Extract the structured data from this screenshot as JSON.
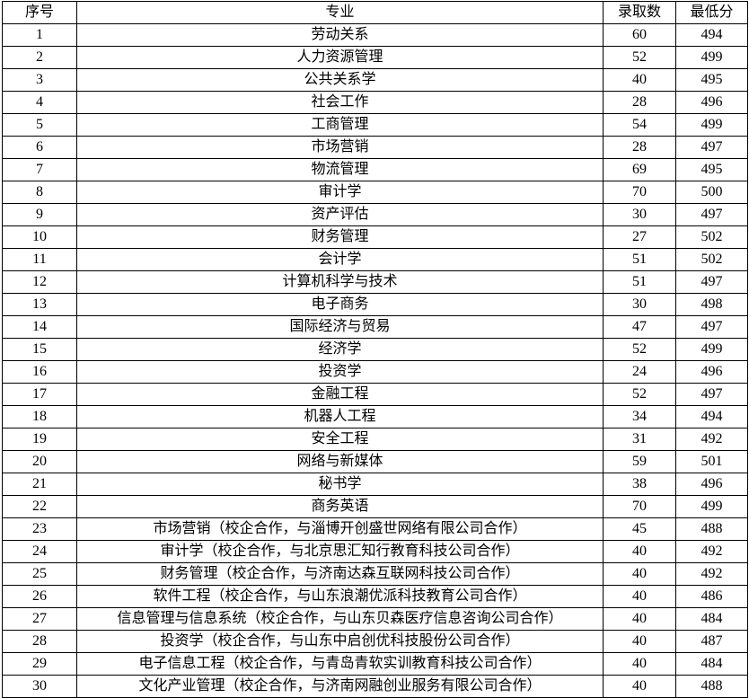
{
  "table": {
    "columns": [
      {
        "key": "seq",
        "label": "序号"
      },
      {
        "key": "major",
        "label": "专业"
      },
      {
        "key": "count",
        "label": "录取数"
      },
      {
        "key": "score",
        "label": "最低分"
      }
    ],
    "rows": [
      {
        "seq": "1",
        "major": "劳动关系",
        "count": "60",
        "score": "494"
      },
      {
        "seq": "2",
        "major": "人力资源管理",
        "count": "52",
        "score": "499"
      },
      {
        "seq": "3",
        "major": "公共关系学",
        "count": "40",
        "score": "495"
      },
      {
        "seq": "4",
        "major": "社会工作",
        "count": "28",
        "score": "496"
      },
      {
        "seq": "5",
        "major": "工商管理",
        "count": "54",
        "score": "499"
      },
      {
        "seq": "6",
        "major": "市场营销",
        "count": "28",
        "score": "497"
      },
      {
        "seq": "7",
        "major": "物流管理",
        "count": "69",
        "score": "495"
      },
      {
        "seq": "8",
        "major": "审计学",
        "count": "70",
        "score": "500"
      },
      {
        "seq": "9",
        "major": "资产评估",
        "count": "30",
        "score": "497"
      },
      {
        "seq": "10",
        "major": "财务管理",
        "count": "27",
        "score": "502"
      },
      {
        "seq": "11",
        "major": "会计学",
        "count": "51",
        "score": "502"
      },
      {
        "seq": "12",
        "major": "计算机科学与技术",
        "count": "51",
        "score": "497"
      },
      {
        "seq": "13",
        "major": "电子商务",
        "count": "30",
        "score": "498"
      },
      {
        "seq": "14",
        "major": "国际经济与贸易",
        "count": "47",
        "score": "497"
      },
      {
        "seq": "15",
        "major": "经济学",
        "count": "52",
        "score": "499"
      },
      {
        "seq": "16",
        "major": "投资学",
        "count": "24",
        "score": "496"
      },
      {
        "seq": "17",
        "major": "金融工程",
        "count": "52",
        "score": "497"
      },
      {
        "seq": "18",
        "major": "机器人工程",
        "count": "34",
        "score": "494"
      },
      {
        "seq": "19",
        "major": "安全工程",
        "count": "31",
        "score": "492"
      },
      {
        "seq": "20",
        "major": "网络与新媒体",
        "count": "59",
        "score": "501"
      },
      {
        "seq": "21",
        "major": "秘书学",
        "count": "38",
        "score": "496"
      },
      {
        "seq": "22",
        "major": "商务英语",
        "count": "70",
        "score": "499"
      },
      {
        "seq": "23",
        "major": "市场营销（校企合作，与淄博开创盛世网络有限公司合作）",
        "count": "45",
        "score": "488"
      },
      {
        "seq": "24",
        "major": "审计学（校企合作，与北京思汇知行教育科技公司合作）",
        "count": "40",
        "score": "492"
      },
      {
        "seq": "25",
        "major": "财务管理（校企合作，与济南达森互联网科技公司合作）",
        "count": "40",
        "score": "492"
      },
      {
        "seq": "26",
        "major": "软件工程（校企合作，与山东浪潮优派科技教育公司合作）",
        "count": "40",
        "score": "486"
      },
      {
        "seq": "27",
        "major": "信息管理与信息系统（校企合作，与山东贝森医疗信息咨询公司合作）",
        "count": "40",
        "score": "484"
      },
      {
        "seq": "28",
        "major": "投资学（校企合作，与山东中启创优科技股份公司合作）",
        "count": "40",
        "score": "487"
      },
      {
        "seq": "29",
        "major": "电子信息工程（校企合作，与青岛青软实训教育科技公司合作）",
        "count": "40",
        "score": "484"
      },
      {
        "seq": "30",
        "major": "文化产业管理（校企合作，与济南网融创业服务有限公司合作）",
        "count": "40",
        "score": "488"
      }
    ]
  }
}
